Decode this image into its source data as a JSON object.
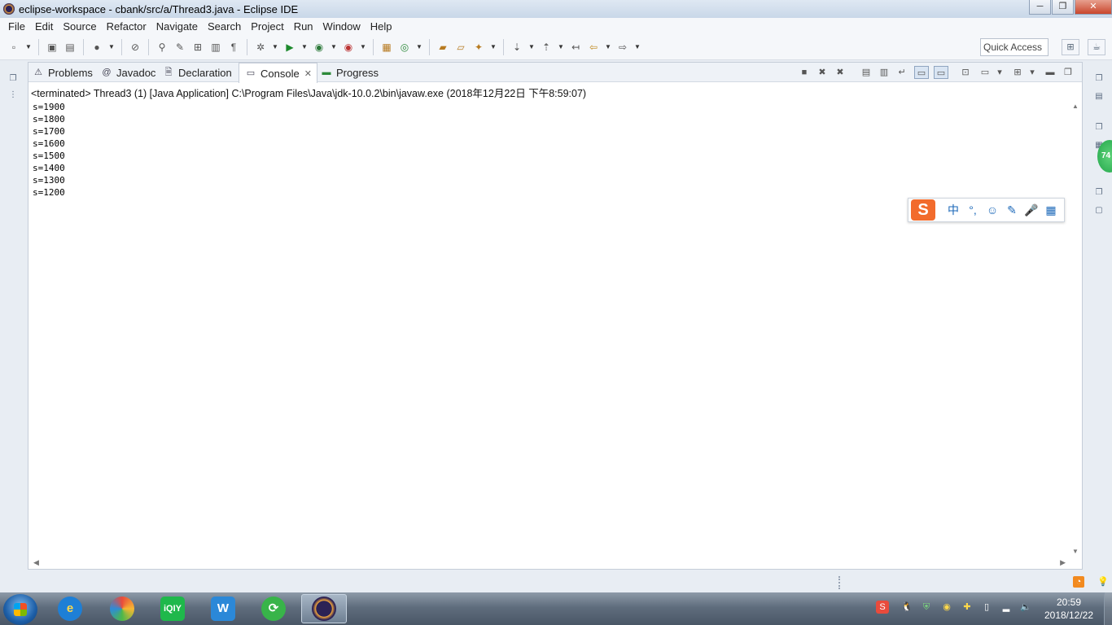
{
  "window": {
    "title": "eclipse-workspace - cbank/src/a/Thread3.java - Eclipse IDE"
  },
  "menu": [
    "File",
    "Edit",
    "Source",
    "Refactor",
    "Navigate",
    "Search",
    "Project",
    "Run",
    "Window",
    "Help"
  ],
  "quick_access": {
    "placeholder": "Quick Access"
  },
  "tabs": [
    {
      "label": "Problems",
      "icon": "problems-icon"
    },
    {
      "label": "Javadoc",
      "icon": "@"
    },
    {
      "label": "Declaration",
      "icon": "declaration-icon"
    },
    {
      "label": "Console",
      "icon": "console-icon",
      "active": true
    },
    {
      "label": "Progress",
      "icon": "progress-icon"
    }
  ],
  "console": {
    "header": "<terminated> Thread3 (1) [Java Application] C:\\Program Files\\Java\\jdk-10.0.2\\bin\\javaw.exe (2018年12月22日 下午8:59:07)",
    "lines": [
      "s=1900",
      "s=1800",
      "s=1700",
      "s=1600",
      "s=1500",
      "s=1400",
      "s=1300",
      "s=1200"
    ]
  },
  "ime": {
    "logo": "S",
    "buttons": [
      "中",
      "°,",
      "☺",
      "✎",
      "🎤",
      "▦"
    ]
  },
  "taskbar": {
    "clock_time": "20:59",
    "clock_date": "2018/12/22",
    "apps": [
      "internet-explorer",
      "app-colorful",
      "iqiyi",
      "wps",
      "refresh-app",
      "eclipse"
    ]
  },
  "side_badge": "74",
  "colors": {
    "accent": "#1d5fa8",
    "ime_logo": "#f26b2c"
  }
}
